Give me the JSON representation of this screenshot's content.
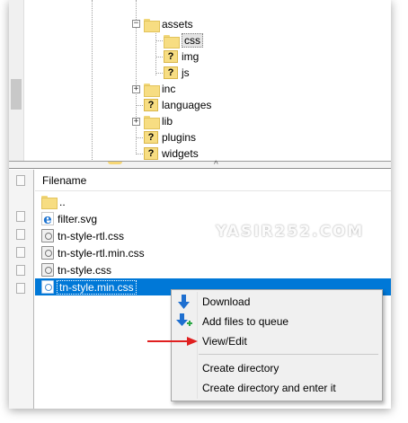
{
  "tree": {
    "items": [
      {
        "label": "assets",
        "kind": "folder"
      },
      {
        "label": "css",
        "kind": "folder"
      },
      {
        "label": "img",
        "kind": "unknown-folder"
      },
      {
        "label": "js",
        "kind": "unknown-folder"
      },
      {
        "label": "inc",
        "kind": "folder"
      },
      {
        "label": "languages",
        "kind": "unknown-folder"
      },
      {
        "label": "lib",
        "kind": "folder"
      },
      {
        "label": "plugins",
        "kind": "unknown-folder"
      },
      {
        "label": "widgets",
        "kind": "unknown-folder"
      }
    ]
  },
  "file_list": {
    "column_header": "Filename",
    "rows": [
      {
        "name": "..",
        "icon": "folder-icon"
      },
      {
        "name": "filter.svg",
        "icon": "edge-browser-icon"
      },
      {
        "name": "tn-style-rtl.css",
        "icon": "css-file-icon"
      },
      {
        "name": "tn-style-rtl.min.css",
        "icon": "css-file-icon"
      },
      {
        "name": "tn-style.css",
        "icon": "css-file-icon"
      },
      {
        "name": "tn-style.min.css",
        "icon": "css-file-icon",
        "selected": true
      }
    ]
  },
  "watermark": "YASIR252.COM",
  "context_menu": {
    "items": [
      {
        "label": "Download",
        "icon": "download-arrow-icon"
      },
      {
        "label": "Add files to queue",
        "icon": "add-to-queue-icon"
      },
      {
        "label": "View/Edit",
        "icon": ""
      },
      {
        "label": "Create directory",
        "icon": ""
      },
      {
        "label": "Create directory and enter it",
        "icon": ""
      }
    ]
  },
  "colors": {
    "selection": "#0078d7",
    "arrow": "#e02020",
    "folder": "#f7dd82",
    "download_icon": "#1e6fd0",
    "queue_plus": "#2ba745"
  }
}
